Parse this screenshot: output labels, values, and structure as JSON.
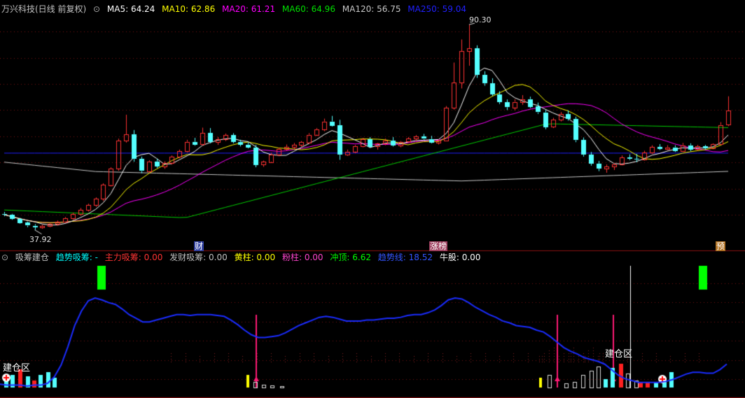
{
  "header": {
    "stock": "万兴科技(日线 前复权)",
    "ma": [
      {
        "label": "MA5: 64.24",
        "color": "#ffffff"
      },
      {
        "label": "MA10: 62.86",
        "color": "#ffff00"
      },
      {
        "label": "MA20: 61.21",
        "color": "#ff00ff"
      },
      {
        "label": "MA60: 64.96",
        "color": "#00e000"
      },
      {
        "label": "MA120: 56.75",
        "color": "#c8c8c8"
      },
      {
        "label": "MA250: 59.04",
        "color": "#2020ff"
      }
    ]
  },
  "indicator_header": {
    "name": "吸筹建仓",
    "items": [
      {
        "label": "趋势吸筹: -",
        "color": "#00ffff"
      },
      {
        "label": "主力吸筹: 0.00",
        "color": "#ff3333"
      },
      {
        "label": "发财吸筹: 0.00",
        "color": "#c0c0c0"
      },
      {
        "label": "黄柱: 0.00",
        "color": "#ffff00"
      },
      {
        "label": "粉柱: 0.00",
        "color": "#ff44cc"
      },
      {
        "label": "冲顶: 6.62",
        "color": "#00ff00"
      },
      {
        "label": "趋势线: 18.52",
        "color": "#3355ff"
      },
      {
        "label": "牛股: 0.00",
        "color": "#ffffff"
      }
    ]
  },
  "annotations": {
    "high_label": "90.30",
    "low_label": "37.92",
    "event_cai": "财",
    "event_zhangbang": "涨榜",
    "event_yu": "预",
    "zone_label_left": "建仓区",
    "zone_label_right": "建仓区"
  },
  "colors": {
    "up": "#ff3232",
    "down": "#54ffff",
    "grid": "#7a1010"
  },
  "chart_data": {
    "type": "candlestick",
    "price_ylim": [
      35,
      93
    ],
    "high": 90.3,
    "low": 37.92,
    "candles": [
      [
        42.0,
        42.5,
        41.4,
        41.8
      ],
      [
        41.8,
        42.0,
        40.5,
        40.8
      ],
      [
        40.8,
        41.0,
        39.5,
        39.8
      ],
      [
        39.8,
        40.0,
        38.6,
        39.0
      ],
      [
        39.0,
        39.4,
        37.92,
        38.6
      ],
      [
        38.6,
        39.2,
        38.2,
        38.9
      ],
      [
        38.9,
        39.6,
        38.6,
        39.4
      ],
      [
        39.4,
        40.3,
        39.0,
        40.0
      ],
      [
        40.0,
        41.2,
        39.7,
        40.9
      ],
      [
        40.9,
        42.3,
        40.5,
        41.9
      ],
      [
        41.9,
        43.5,
        41.5,
        43.0
      ],
      [
        43.0,
        44.6,
        42.6,
        44.2
      ],
      [
        44.2,
        46.2,
        43.8,
        45.8
      ],
      [
        45.8,
        49.8,
        45.3,
        49.4
      ],
      [
        49.4,
        53.9,
        49.0,
        53.6
      ],
      [
        53.6,
        61.2,
        53.0,
        60.7
      ],
      [
        60.7,
        67.3,
        60.2,
        62.3
      ],
      [
        62.3,
        63.4,
        55.3,
        56.0
      ],
      [
        56.0,
        56.6,
        52.4,
        52.9
      ],
      [
        52.9,
        55.7,
        52.6,
        55.4
      ],
      [
        55.4,
        56.1,
        53.7,
        54.1
      ],
      [
        54.1,
        55.4,
        53.5,
        55.0
      ],
      [
        55.0,
        56.9,
        54.6,
        56.6
      ],
      [
        56.6,
        58.4,
        56.2,
        58.0
      ],
      [
        58.0,
        60.9,
        57.7,
        60.4
      ],
      [
        60.4,
        61.4,
        59.4,
        59.7
      ],
      [
        59.7,
        64.0,
        59.4,
        62.6
      ],
      [
        62.6,
        63.9,
        60.0,
        60.3
      ],
      [
        60.3,
        61.6,
        59.6,
        61.0
      ],
      [
        61.0,
        62.5,
        60.6,
        62.1
      ],
      [
        62.1,
        62.6,
        60.0,
        60.4
      ],
      [
        60.4,
        60.9,
        59.2,
        59.7
      ],
      [
        59.7,
        60.2,
        58.7,
        59.0
      ],
      [
        59.0,
        59.6,
        53.9,
        54.5
      ],
      [
        54.5,
        55.6,
        54.0,
        55.3
      ],
      [
        55.3,
        57.6,
        55.0,
        57.2
      ],
      [
        57.2,
        58.9,
        56.7,
        58.6
      ],
      [
        58.6,
        59.7,
        58.2,
        59.1
      ],
      [
        59.1,
        60.1,
        58.6,
        59.6
      ],
      [
        59.6,
        60.6,
        59.1,
        60.3
      ],
      [
        60.3,
        62.6,
        60.0,
        62.2
      ],
      [
        62.2,
        63.9,
        61.9,
        63.6
      ],
      [
        63.6,
        66.3,
        63.1,
        65.6
      ],
      [
        65.6,
        67.0,
        64.3,
        64.6
      ],
      [
        64.6,
        66.0,
        55.8,
        57.1
      ],
      [
        57.1,
        58.4,
        56.8,
        57.9
      ],
      [
        57.9,
        59.6,
        57.5,
        59.3
      ],
      [
        59.3,
        61.4,
        59.0,
        61.1
      ],
      [
        61.1,
        61.6,
        58.9,
        59.2
      ],
      [
        59.2,
        60.1,
        58.4,
        59.9
      ],
      [
        59.9,
        61.2,
        59.5,
        60.7
      ],
      [
        60.7,
        61.6,
        59.2,
        59.5
      ],
      [
        59.5,
        60.6,
        59.0,
        60.4
      ],
      [
        60.4,
        61.6,
        60.2,
        61.2
      ],
      [
        61.2,
        62.1,
        60.6,
        61.7
      ],
      [
        61.7,
        62.4,
        60.8,
        61.1
      ],
      [
        61.1,
        61.9,
        60.0,
        60.2
      ],
      [
        60.2,
        61.0,
        59.7,
        60.7
      ],
      [
        60.7,
        69.5,
        60.6,
        69.0
      ],
      [
        69.0,
        80.6,
        68.6,
        75.5
      ],
      [
        75.5,
        86.5,
        74.0,
        83.5
      ],
      [
        83.5,
        90.3,
        79.8,
        84.2
      ],
      [
        84.2,
        85.0,
        76.7,
        77.5
      ],
      [
        77.5,
        78.4,
        74.7,
        75.3
      ],
      [
        75.3,
        76.6,
        72.1,
        72.5
      ],
      [
        72.5,
        73.3,
        70.0,
        70.5
      ],
      [
        70.5,
        71.2,
        68.5,
        69.2
      ],
      [
        69.2,
        71.2,
        68.4,
        70.6
      ],
      [
        70.6,
        72.3,
        69.8,
        71.3
      ],
      [
        71.3,
        71.9,
        69.0,
        69.4
      ],
      [
        69.4,
        70.4,
        67.5,
        67.9
      ],
      [
        67.9,
        68.5,
        63.6,
        64.2
      ],
      [
        64.2,
        66.5,
        63.9,
        66.0
      ],
      [
        66.0,
        68.0,
        65.6,
        67.4
      ],
      [
        67.4,
        68.4,
        65.8,
        66.2
      ],
      [
        66.2,
        66.8,
        60.3,
        60.8
      ],
      [
        60.8,
        61.5,
        56.6,
        57.1
      ],
      [
        57.1,
        57.8,
        54.3,
        54.8
      ],
      [
        54.8,
        55.5,
        52.9,
        53.6
      ],
      [
        53.6,
        54.6,
        52.5,
        54.1
      ],
      [
        54.1,
        55.0,
        53.2,
        54.7
      ],
      [
        54.7,
        56.9,
        54.4,
        56.4
      ],
      [
        56.4,
        57.2,
        55.7,
        56.0
      ],
      [
        56.0,
        57.3,
        55.2,
        55.8
      ],
      [
        55.8,
        58.1,
        55.6,
        57.6
      ],
      [
        57.6,
        59.5,
        57.3,
        59.1
      ],
      [
        59.1,
        59.8,
        58.3,
        58.6
      ],
      [
        58.6,
        59.5,
        58.3,
        59.0
      ],
      [
        59.0,
        59.5,
        57.8,
        58.1
      ],
      [
        58.1,
        60.1,
        57.9,
        59.5
      ],
      [
        59.5,
        60.0,
        58.0,
        58.4
      ],
      [
        58.4,
        59.6,
        58.1,
        59.2
      ],
      [
        59.2,
        59.6,
        58.4,
        58.7
      ],
      [
        58.7,
        60.0,
        58.5,
        59.8
      ],
      [
        59.8,
        65.4,
        59.6,
        64.7
      ],
      [
        64.7,
        72.0,
        64.4,
        68.3
      ]
    ],
    "indicator_ylim": [
      0,
      100
    ],
    "trend_line": [
      4,
      3,
      3,
      3,
      2,
      3,
      3,
      5,
      12,
      25,
      45,
      68,
      84,
      95,
      98,
      96,
      93,
      91,
      86,
      80,
      76,
      72,
      72,
      74,
      76,
      78,
      80,
      80,
      79,
      80,
      80,
      80,
      79,
      78,
      74,
      69,
      63,
      58,
      55,
      55,
      56,
      57,
      60,
      64,
      68,
      71,
      74,
      77,
      78,
      77,
      75,
      73,
      73,
      73,
      74,
      74,
      75,
      76,
      76,
      77,
      79,
      80,
      80,
      82,
      85,
      90,
      96,
      98,
      97,
      93,
      88,
      84,
      80,
      77,
      73,
      71,
      68,
      67,
      66,
      63,
      61,
      56,
      50,
      44,
      40,
      37,
      33,
      31,
      29,
      26,
      20,
      14,
      10,
      8,
      6,
      6,
      6,
      6,
      7,
      9,
      12,
      15,
      17,
      17,
      16,
      16,
      20,
      26
    ]
  }
}
